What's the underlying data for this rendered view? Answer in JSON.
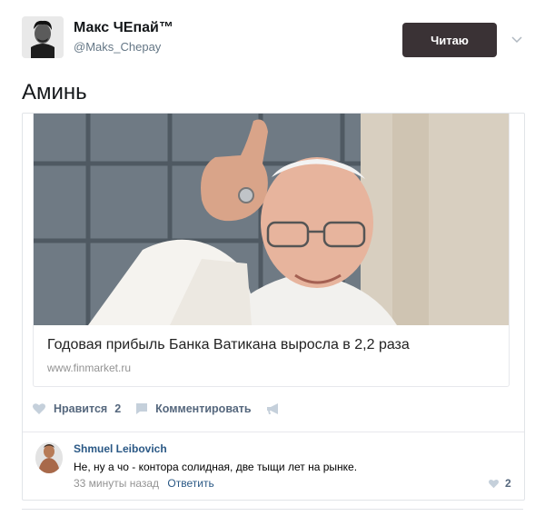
{
  "tweet": {
    "display_name": "Макс ЧЕпай™",
    "username": "@Maks_Chepay",
    "follow_label": "Читаю",
    "text": "Аминь"
  },
  "vk_post": {
    "link": {
      "title": "Годовая прибыль Банка Ватикана выросла в 2,2 раза",
      "domain": "www.finmarket.ru"
    },
    "actions": {
      "like_label": "Нравится",
      "like_count": "2",
      "comment_label": "Комментировать"
    },
    "comment": {
      "author": "Shmuel Leibovich",
      "text": "Не, ну а чо - контора солидная, две тыщи лет на рынке.",
      "time": "33 минуты назад",
      "reply_label": "Ответить",
      "likes": "2"
    }
  },
  "colors": {
    "follow_button": "#3a3235",
    "vk_link": "#2a5885",
    "vk_action": "#55677d",
    "muted": "#939393"
  },
  "icons": [
    "avatar-portrait",
    "chevron-down-icon",
    "heart-icon",
    "comment-icon",
    "megaphone-icon"
  ]
}
